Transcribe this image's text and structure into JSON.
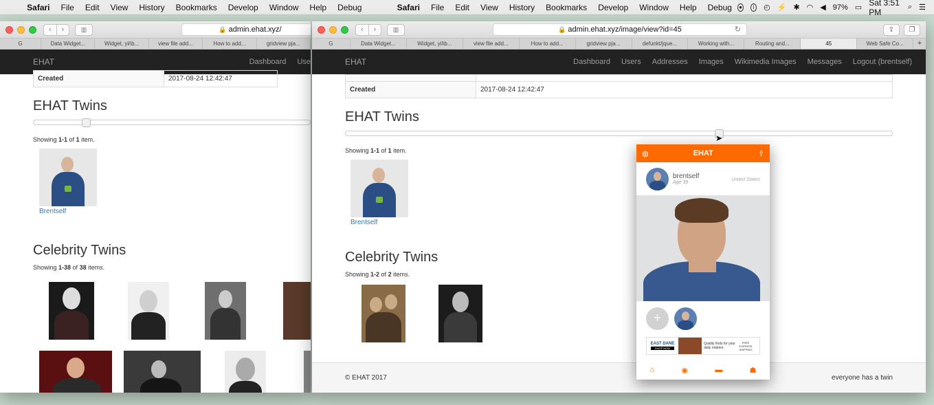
{
  "menubar": {
    "items": [
      "Safari",
      "File",
      "Edit",
      "View",
      "History",
      "Bookmarks",
      "Develop",
      "Window",
      "Help",
      "Debug"
    ],
    "left_items": [
      "Safari",
      "File",
      "Edit",
      "View",
      "History",
      "Bookmarks",
      "Develop",
      "Window",
      "Help",
      "Debug"
    ],
    "battery": "97%",
    "clock": "Sat 3:51 PM"
  },
  "window_left": {
    "url": "admin.ehat.xyz/",
    "tabs": [
      "G",
      "Data Widget...",
      "Widget, yii\\b...",
      "view file add...",
      "How to add...",
      "gridview pja..."
    ],
    "nav_brand": "EHAT",
    "nav_items": [
      "Dashboard",
      "Use"
    ],
    "created_label": "Created",
    "created_value": "2017-08-24 12:42:47",
    "ehat_title": "EHAT Twins",
    "ehat_summary": {
      "pre": "Showing ",
      "range": "1-1",
      "mid": " of ",
      "total": "1",
      "post": " item."
    },
    "ehat_link": "Brentself",
    "celeb_title": "Celebrity Twins",
    "celeb_summary": {
      "pre": "Showing ",
      "range": "1-38",
      "mid": " of ",
      "total": "38",
      "post": " items."
    }
  },
  "window_right": {
    "url": "admin.ehat.xyz/image/view?id=45",
    "tabs": [
      "G",
      "Data Widget...",
      "Widget, yii\\b...",
      "view file add...",
      "How to add...",
      "gridview pja...",
      "defunkt/jque...",
      "Working with...",
      "Routing and...",
      "45",
      "Web Safe Co..."
    ],
    "active_tab_index": 9,
    "nav_brand": "EHAT",
    "nav_items": [
      "Dashboard",
      "Users",
      "Addresses",
      "Images",
      "Wikimedia Images",
      "Messages",
      "Logout (brentself)"
    ],
    "created_label": "Created",
    "created_value": "2017-08-24 12:42:47",
    "ehat_title": "EHAT Twins",
    "slider_value_fraction": 0.675,
    "ehat_summary": {
      "pre": "Showing ",
      "range": "1-1",
      "mid": " of ",
      "total": "1",
      "post": " item."
    },
    "ehat_link": "Brentself",
    "celeb_title": "Celebrity Twins",
    "celeb_summary": {
      "pre": "Showing ",
      "range": "1-2",
      "mid": " of ",
      "total": "2",
      "post": " items."
    },
    "footer_left": "© EHAT 2017",
    "footer_right": "everyone has a twin"
  },
  "phone": {
    "title": "EHAT",
    "username": "brentself",
    "age": "Age 39",
    "country": "United States",
    "ad_brand": "EAST DANE",
    "ad_cta": "SHOP NOW",
    "ad_text": "Quality finds for your daily rotation.",
    "ad_shipping": "FREE EXPRESS SHIPPING",
    "accent": "#ff6a00",
    "tab_icons": [
      "home-icon",
      "camera-icon",
      "chat-icon",
      "person-icon"
    ]
  }
}
